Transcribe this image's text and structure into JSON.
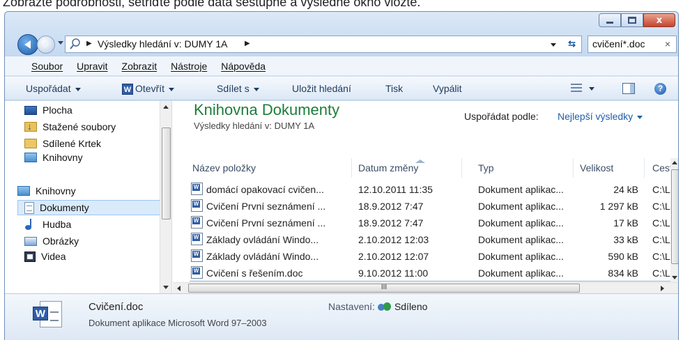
{
  "caption": "Zobrazte podrobnosti, setřiďte podle data sestupně a výsledné okno vložte.",
  "address": {
    "path": "Výsledky hledání v: DUMY 1A"
  },
  "search": {
    "query": "cvičení*.doc",
    "clear_glyph": "×"
  },
  "window_buttons": {
    "close_glyph": "x"
  },
  "menu": [
    "Soubor",
    "Upravit",
    "Zobrazit",
    "Nástroje",
    "Nápověda"
  ],
  "toolbar": {
    "organize": "Uspořádat",
    "open": "Otevřít",
    "open_icon": "W",
    "share": "Sdílet s",
    "save_search": "Uložit hledání",
    "print": "Tisk",
    "burn": "Vypálit",
    "help_glyph": "?"
  },
  "nav": {
    "items": [
      {
        "label": "Plocha",
        "icon": "desktop-icon"
      },
      {
        "label": "Stažené soubory",
        "icon": "downloads-folder-icon"
      },
      {
        "label": "Sdílené Krtek",
        "icon": "folder-icon"
      },
      {
        "label": "Knihovny",
        "icon": "library-icon"
      },
      {
        "label": "Knihovny",
        "icon": "library-icon"
      },
      {
        "label": "Dokumenty",
        "icon": "documents-icon",
        "selected": true
      },
      {
        "label": "Hudba",
        "icon": "music-icon"
      },
      {
        "label": "Obrázky",
        "icon": "pictures-icon"
      },
      {
        "label": "Videa",
        "icon": "video-icon"
      }
    ]
  },
  "library": {
    "title": "Knihovna Dokumenty",
    "subtitle": "Výsledky hledání v: DUMY 1A",
    "arrange_label": "Uspořádat podle:",
    "arrange_value": "Nejlepší výsledky"
  },
  "table": {
    "columns": [
      "Název položky",
      "Datum změny",
      "Typ",
      "Velikost",
      "Cest"
    ],
    "rows": [
      {
        "name": "domácí opakovací cvičen...",
        "date": "12.10.2011 11:35",
        "type": "Dokument aplikac...",
        "size": "24 kB",
        "path": "C:\\L"
      },
      {
        "name": "Cvičení První seznámení ...",
        "date": "18.9.2012 7:47",
        "type": "Dokument aplikac...",
        "size": "1 297 kB",
        "path": "C:\\L"
      },
      {
        "name": "Cvičení První seznámení ...",
        "date": "18.9.2012 7:47",
        "type": "Dokument aplikac...",
        "size": "17 kB",
        "path": "C:\\L"
      },
      {
        "name": "Základy ovládání Windo...",
        "date": "2.10.2012 12:03",
        "type": "Dokument aplikac...",
        "size": "33 kB",
        "path": "C:\\L"
      },
      {
        "name": "Základy ovládání Windo...",
        "date": "2.10.2012 12:07",
        "type": "Dokument aplikac...",
        "size": "590 kB",
        "path": "C:\\L"
      },
      {
        "name": "Cvičení s řešením.doc",
        "date": "9.10.2012 11:00",
        "type": "Dokument aplikac...",
        "size": "834 kB",
        "path": "C:\\L"
      }
    ],
    "word_icon_letter": "W",
    "hscroll_grip": "III"
  },
  "details": {
    "file_name": "Cvičení.doc",
    "file_type": "Dokument aplikace Microsoft Word 97–2003",
    "sharing_label": "Nastavení:",
    "sharing_value": "Sdíleno"
  }
}
